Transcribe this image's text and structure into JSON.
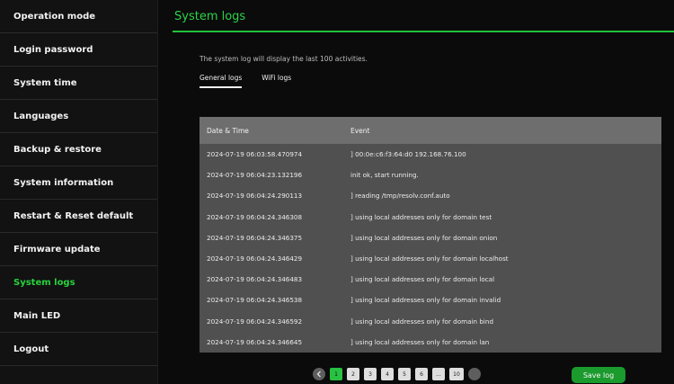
{
  "sidebar": {
    "items": [
      {
        "label": "Operation mode"
      },
      {
        "label": "Login password"
      },
      {
        "label": "System time"
      },
      {
        "label": "Languages"
      },
      {
        "label": "Backup & restore"
      },
      {
        "label": "System information"
      },
      {
        "label": "Restart & Reset default"
      },
      {
        "label": "Firmware update"
      },
      {
        "label": "System logs",
        "active": true
      },
      {
        "label": "Main LED"
      },
      {
        "label": "Logout"
      }
    ]
  },
  "main": {
    "title": "System logs",
    "description": "The system log will display the last 100 activities.",
    "tabs": [
      {
        "label": "General logs",
        "active": true
      },
      {
        "label": "WiFi logs"
      }
    ]
  },
  "table": {
    "headers": [
      "Date & Time",
      "Event"
    ],
    "rows": [
      {
        "date": "2024-07-19 06:03:58.470974",
        "event": "] 00:0e:c6:f3:64:d0 192.168.76.100"
      },
      {
        "date": "2024-07-19 06:04:23.132196",
        "event": "init ok, start running."
      },
      {
        "date": "2024-07-19 06:04:24.290113",
        "event": "] reading /tmp/resolv.conf.auto"
      },
      {
        "date": "2024-07-19 06:04:24.346308",
        "event": "] using local addresses only for domain test"
      },
      {
        "date": "2024-07-19 06:04:24.346375",
        "event": "] using local addresses only for domain onion"
      },
      {
        "date": "2024-07-19 06:04:24.346429",
        "event": "] using local addresses only for domain localhost"
      },
      {
        "date": "2024-07-19 06:04:24.346483",
        "event": "] using local addresses only for domain local"
      },
      {
        "date": "2024-07-19 06:04:24.346538",
        "event": "] using local addresses only for domain invalid"
      },
      {
        "date": "2024-07-19 06:04:24.346592",
        "event": "] using local addresses only for domain bind"
      },
      {
        "date": "2024-07-19 06:04:24.346645",
        "event": "] using local addresses only for domain lan"
      }
    ]
  },
  "pagination": {
    "prev_icon": "chevron-left-icon",
    "next_icon": "chevron-right-icon",
    "pages": [
      "1",
      "2",
      "3",
      "4",
      "5",
      "6",
      "...",
      "10"
    ],
    "current": "1"
  },
  "actions": {
    "save_label": "Save log"
  },
  "colors": {
    "accent": "#27d23d",
    "button": "#1b9a2d",
    "table_header": "#6e6e6e",
    "table_body": "#505050"
  }
}
